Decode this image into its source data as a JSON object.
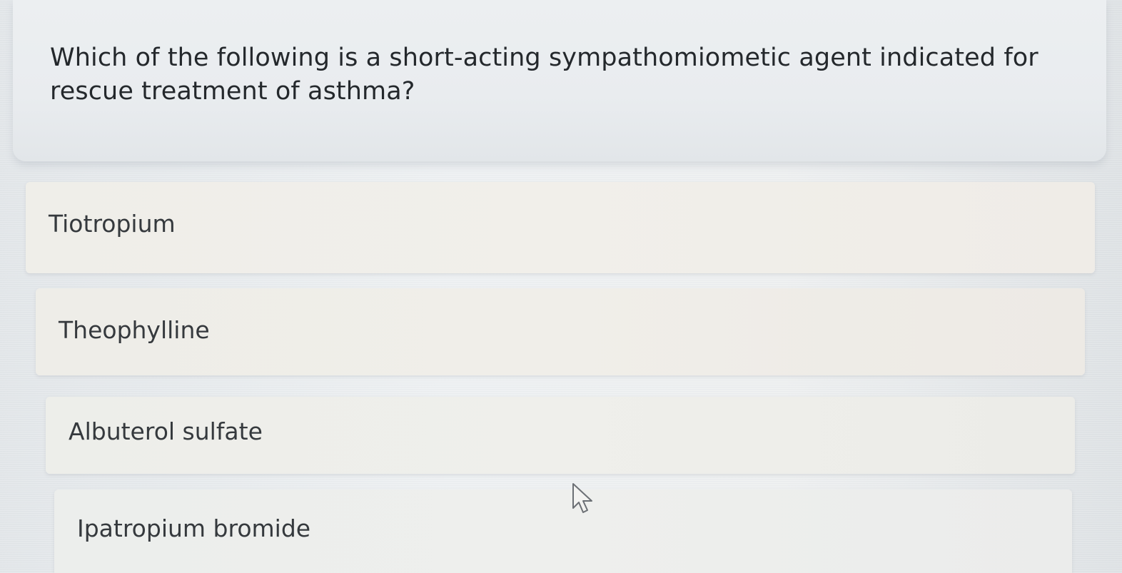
{
  "question": {
    "text": "Which of the following is a short-acting sympathomiometic agent indicated for rescue treatment of asthma?"
  },
  "options": [
    {
      "label": "Tiotropium"
    },
    {
      "label": "Theophylline"
    },
    {
      "label": "Albuterol sulfate"
    },
    {
      "label": "Ipatropium bromide"
    }
  ],
  "colors": {
    "background": "#eef1f3",
    "option_background": "#f0eee9",
    "text": "#2f3338"
  },
  "icons": {
    "pointer": "mouse-pointer-icon"
  }
}
